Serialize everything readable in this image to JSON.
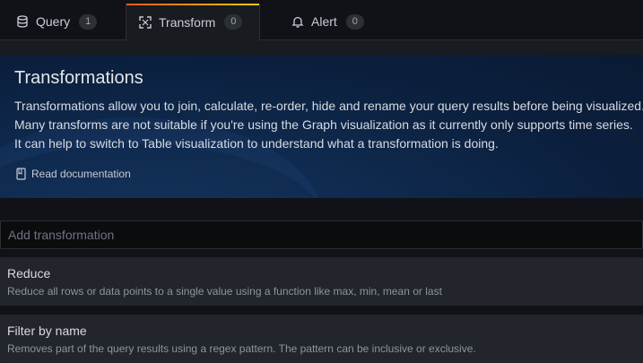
{
  "tabs": [
    {
      "label": "Query",
      "count": "1",
      "icon": "database-icon"
    },
    {
      "label": "Transform",
      "count": "0",
      "icon": "transform-icon",
      "active": true
    },
    {
      "label": "Alert",
      "count": "0",
      "icon": "bell-icon"
    }
  ],
  "banner": {
    "title": "Transformations",
    "lines": [
      "Transformations allow you to join, calculate, re-order, hide and rename your query results before being visualized.",
      "Many transforms are not suitable if you're using the Graph visualization as it currently only supports time series.",
      "It can help to switch to Table visualization to understand what a transformation is doing."
    ],
    "doc_link": "Read documentation",
    "doc_icon": "book-icon"
  },
  "add_transformation": {
    "placeholder": "Add transformation"
  },
  "transformations": [
    {
      "title": "Reduce",
      "description": "Reduce all rows or data points to a single value using a function like max, min, mean or last"
    },
    {
      "title": "Filter by name",
      "description": "Removes part of the query results using a regex pattern. The pattern can be inclusive or exclusive."
    }
  ],
  "colors": {
    "accent_gradient_start": "#f05a28",
    "accent_gradient_end": "#fbca0a",
    "banner_bg": "#0f2a4e",
    "page_bg": "#111217",
    "card_bg": "#22252b"
  }
}
